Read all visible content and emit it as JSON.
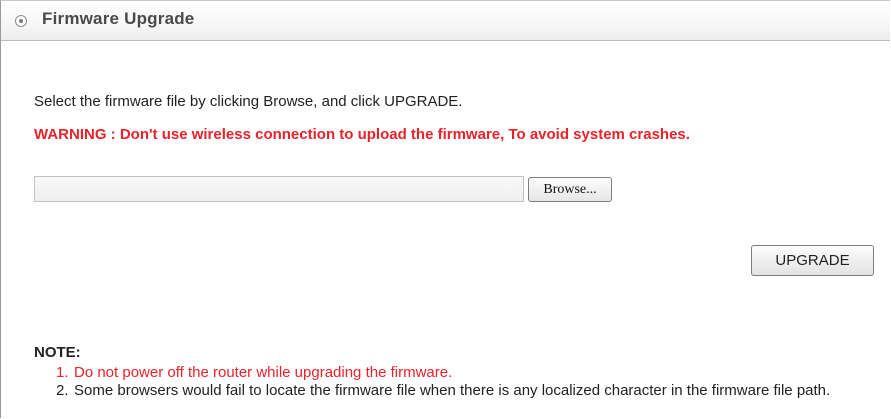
{
  "header": {
    "title": "Firmware Upgrade",
    "icon": "radio-icon"
  },
  "main": {
    "instruction": "Select the firmware file by clicking Browse, and click UPGRADE.",
    "warning": "WARNING : Don't use wireless connection to upload the firmware, To avoid system crashes.",
    "file_input": {
      "value": "",
      "placeholder": ""
    },
    "browse_label": "Browse...",
    "upgrade_label": "UPGRADE"
  },
  "notes": {
    "label": "NOTE:",
    "items": [
      {
        "number": "1.",
        "text": "Do not power off the router while upgrading the firmware.",
        "color": "#e8232a"
      },
      {
        "number": "2.",
        "text": "Some browsers would fail to locate the firmware file when there is any localized character in the firmware file path.",
        "color": "#222222"
      }
    ]
  },
  "colors": {
    "warning": "#e8232a",
    "title": "#4a4a4a",
    "text": "#222222"
  }
}
